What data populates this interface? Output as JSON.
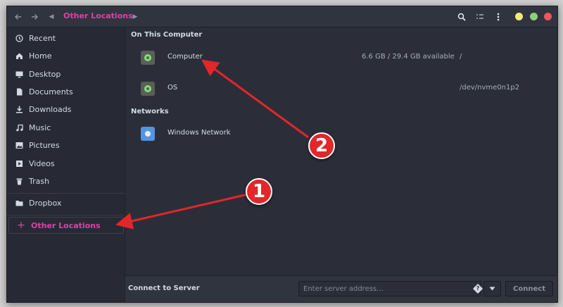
{
  "header": {
    "path_label": "Other Locations",
    "icons": [
      "go-back-icon",
      "go-forward-icon",
      "path-left-icon",
      "path-right-icon",
      "search-icon",
      "view-options-icon",
      "menu-icon"
    ],
    "window_controls": {
      "minimize_color": "#f6e97a",
      "maximize_color": "#8bd27a",
      "close_color": "#f2545b"
    }
  },
  "sidebar": {
    "items": [
      {
        "label": "Recent",
        "icon": "clock-icon"
      },
      {
        "label": "Home",
        "icon": "home-icon"
      },
      {
        "label": "Desktop",
        "icon": "desktop-icon"
      },
      {
        "label": "Documents",
        "icon": "document-icon"
      },
      {
        "label": "Downloads",
        "icon": "download-icon"
      },
      {
        "label": "Music",
        "icon": "music-icon"
      },
      {
        "label": "Pictures",
        "icon": "picture-icon"
      },
      {
        "label": "Videos",
        "icon": "video-icon"
      },
      {
        "label": "Trash",
        "icon": "trash-icon"
      },
      {
        "label": "Dropbox",
        "icon": "folder-icon"
      },
      {
        "label": "Other Locations",
        "icon": "plus-icon",
        "active": true
      }
    ]
  },
  "main": {
    "on_this_computer_title": "On This Computer",
    "computer": {
      "name": "Computer",
      "size": "6.6 GB / 29.4 GB available",
      "path": "/"
    },
    "os": {
      "name": "OS",
      "path": "/dev/nvme0n1p2"
    },
    "networks_title": "Networks",
    "windows_network": {
      "name": "Windows Network"
    }
  },
  "footer": {
    "label": "Connect to Server",
    "server_placeholder": "Enter server address…",
    "connect_label": "Connect"
  },
  "annotations": {
    "badge_1": "1",
    "badge_2": "2",
    "color": "#e2262a"
  },
  "accent_color": "#e040a8"
}
